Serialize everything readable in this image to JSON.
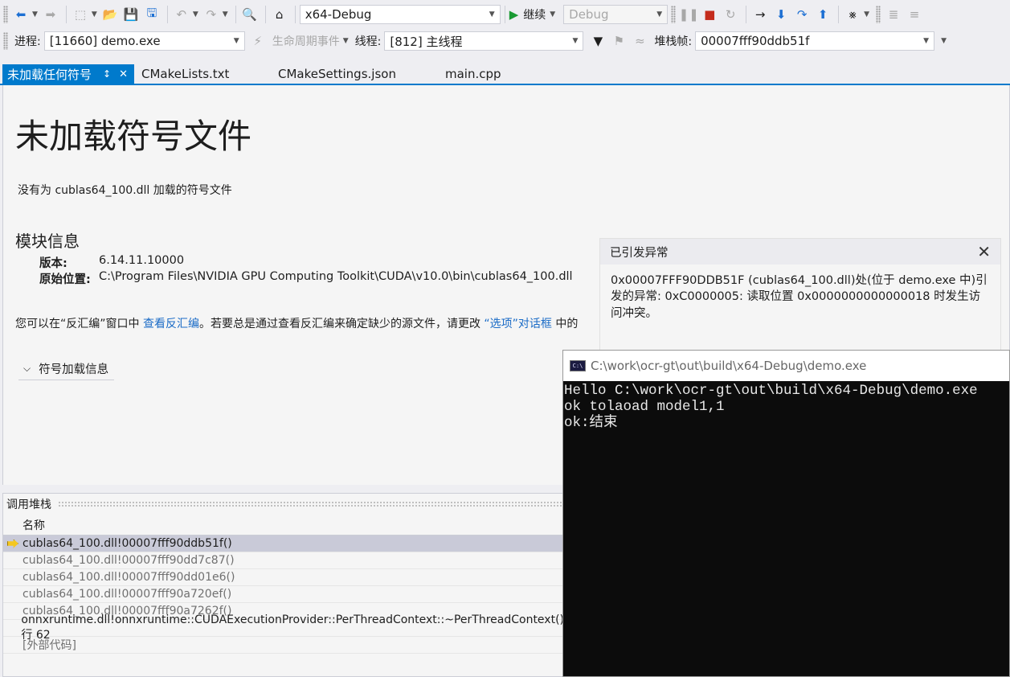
{
  "toolbar1": {
    "config": "x64-Debug",
    "continue_label": "继续",
    "platform": "Debug"
  },
  "toolbar2": {
    "process_label": "进程:",
    "process_value": "[11660] demo.exe",
    "lifecycle_label": "生命周期事件",
    "thread_label": "线程:",
    "thread_value": "[812] 主线程",
    "stackframe_label": "堆栈帧:",
    "stackframe_value": "00007fff90ddb51f"
  },
  "tabs": [
    {
      "label": "未加载任何符号",
      "active": true
    },
    {
      "label": "CMakeLists.txt"
    },
    {
      "label": "CMakeSettings.json"
    },
    {
      "label": "main.cpp"
    }
  ],
  "doc": {
    "title": "未加载符号文件",
    "description": "没有为 cublas64_100.dll 加载的符号文件",
    "module_heading": "模块信息",
    "version_key": "版本:",
    "version_value": "6.14.11.10000",
    "location_key": "原始位置:",
    "location_value": "C:\\Program Files\\NVIDIA GPU Computing Toolkit\\CUDA\\v10.0\\bin\\cublas64_100.dll",
    "hint_prefix": "您可以在“反汇编”窗口中 ",
    "hint_link1": "查看反汇编",
    "hint_middle": "。若要总是通过查看反汇编来确定缺少的源文件，请更改 ",
    "hint_link2": "“选项”对话框",
    "hint_suffix": " 中的",
    "symbol_load_info": "符号加载信息"
  },
  "exception": {
    "title": "已引发异常",
    "message": "0x00007FFF90DDB51F (cublas64_100.dll)处(位于 demo.exe 中)引发的异常: 0xC0000005: 读取位置 0x0000000000000018 时发生访问冲突。"
  },
  "callstack": {
    "title": "调用堆栈",
    "column_name": "名称",
    "rows": [
      "cublas64_100.dll!00007fff90ddb51f()",
      "cublas64_100.dll!00007fff90dd7c87()",
      "cublas64_100.dll!00007fff90dd01e6()",
      "cublas64_100.dll!00007fff90a720ef()",
      "cublas64_100.dll!00007fff90a7262f()",
      "onnxruntime.dll!onnxruntime::CUDAExecutionProvider::PerThreadContext::~PerThreadContext() 行 62",
      "[外部代码]"
    ]
  },
  "console": {
    "title": "C:\\work\\ocr-gt\\out\\build\\x64-Debug\\demo.exe",
    "lines": [
      "Hello C:\\work\\ocr-gt\\out\\build\\x64-Debug\\demo.exe",
      "ok tolaoad model1,1",
      "ok:结束"
    ]
  },
  "colors": {
    "accent": "#007acc",
    "link": "#1a6bc6",
    "selected_row": "#c9cad8",
    "console_bg": "#0c0c0c"
  }
}
